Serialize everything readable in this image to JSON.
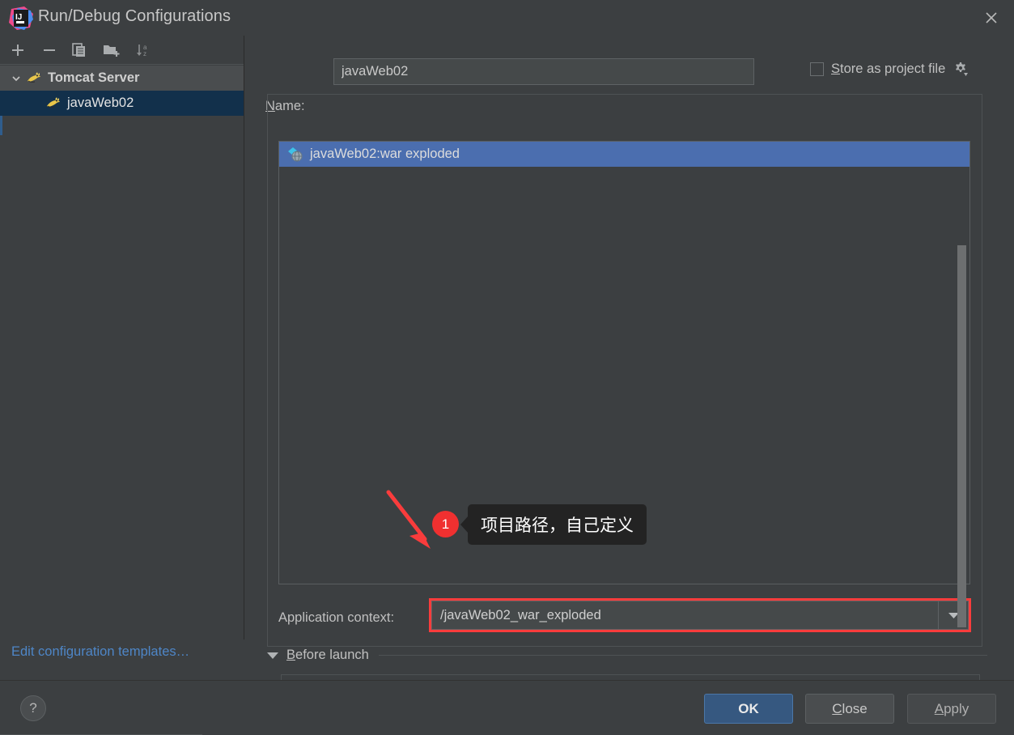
{
  "window": {
    "title": "Run/Debug Configurations",
    "logo_icon": "intellij-idea-logo",
    "close_icon": "close-icon"
  },
  "toolbar": {
    "add_icon": "plus-icon",
    "remove_icon": "minus-icon",
    "copy_icon": "copy-icon",
    "folder_icon": "new-folder-icon",
    "sort_icon": "sort-alphabetically-icon"
  },
  "sidebar": {
    "group": {
      "label": "Tomcat Server",
      "icon": "tomcat-icon",
      "expanded": true,
      "chevron_icon": "chevron-down-icon"
    },
    "items": [
      {
        "label": "javaWeb02",
        "icon": "tomcat-icon",
        "selected": true
      }
    ],
    "edit_templates_link": "Edit configuration templates…"
  },
  "form": {
    "name_label": "Name:",
    "name_label_mnemonic": "N",
    "name_label_rest": "ame:",
    "name_value": "javaWeb02",
    "store_as_project_file": {
      "label": "Store as project file",
      "mnemonic": "S",
      "label_rest": "tore as project file",
      "checked": false,
      "gear_icon": "gear-icon"
    }
  },
  "deployment": {
    "items": [
      {
        "label": "javaWeb02:war exploded",
        "icon": "artifact-icon",
        "selected": true
      }
    ],
    "application_context_label": "Application context:",
    "application_context_value": "/javaWeb02_war_exploded",
    "dropdown_icon": "chevron-down-icon"
  },
  "before_launch": {
    "label": "Before launch",
    "mnemonic": "B",
    "label_rest": "efore launch",
    "expanded": true,
    "triangle_icon": "triangle-down-icon"
  },
  "footer": {
    "help_label": "?",
    "help_icon": "question-mark-icon",
    "buttons": [
      {
        "id": "ok",
        "label": "OK",
        "primary": true
      },
      {
        "id": "close",
        "label": "Close",
        "mnemonic": "C",
        "label_rest": "lose"
      },
      {
        "id": "apply",
        "label": "Apply",
        "mnemonic": "A",
        "label_rest": "pply"
      }
    ]
  },
  "annotation": {
    "badge_number": "1",
    "tooltip_text": "项目路径，自己定义",
    "arrow_color": "#f93c3c",
    "badge_color": "#f03030",
    "highlight_color": "#f93c3c"
  },
  "colors": {
    "background": "#3c3f41",
    "selection_blue": "#4b6eaf",
    "tree_selection": "#12304b",
    "accent_link": "#4e86c7",
    "primary_button": "#365880"
  }
}
